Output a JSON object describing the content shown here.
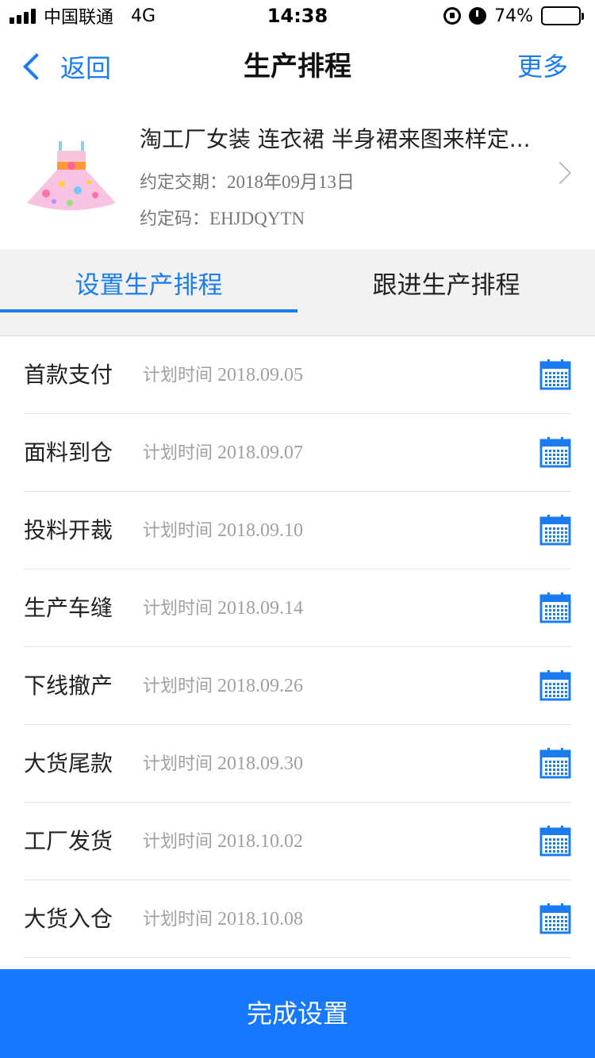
{
  "status_bar": {
    "carrier": "中国联通",
    "network": "4G",
    "time": "14:38",
    "battery_text": "74%",
    "battery_level": 0.74
  },
  "nav": {
    "back_label": "返回",
    "title": "生产排程",
    "more_label": "更多",
    "accent_color": "#1a7cf0"
  },
  "product": {
    "title": "淘工厂女装 连衣裙 半身裙来图来样定...",
    "delivery_label": "约定交期：",
    "delivery_value": "2018年09月13日",
    "code_label": "约定码：",
    "code_value": "EHJDQYTN"
  },
  "tabs": [
    {
      "label": "设置生产排程",
      "active": true
    },
    {
      "label": "跟进生产排程",
      "active": false
    }
  ],
  "plan_prefix": "计划时间",
  "schedule": [
    {
      "name": "首款支付",
      "date": "2018.09.05"
    },
    {
      "name": "面料到仓",
      "date": "2018.09.07"
    },
    {
      "name": "投料开裁",
      "date": "2018.09.10"
    },
    {
      "name": "生产车缝",
      "date": "2018.09.14"
    },
    {
      "name": "下线撤产",
      "date": "2018.09.26"
    },
    {
      "name": "大货尾款",
      "date": "2018.09.30"
    },
    {
      "name": "工厂发货",
      "date": "2018.10.02"
    },
    {
      "name": "大货入仓",
      "date": "2018.10.08"
    }
  ],
  "icons": {
    "calendar": "calendar-icon",
    "back": "chevron-left-icon",
    "disclosure": "chevron-right-icon"
  },
  "done_button": {
    "label": "完成设置",
    "color": "#1677ff"
  }
}
